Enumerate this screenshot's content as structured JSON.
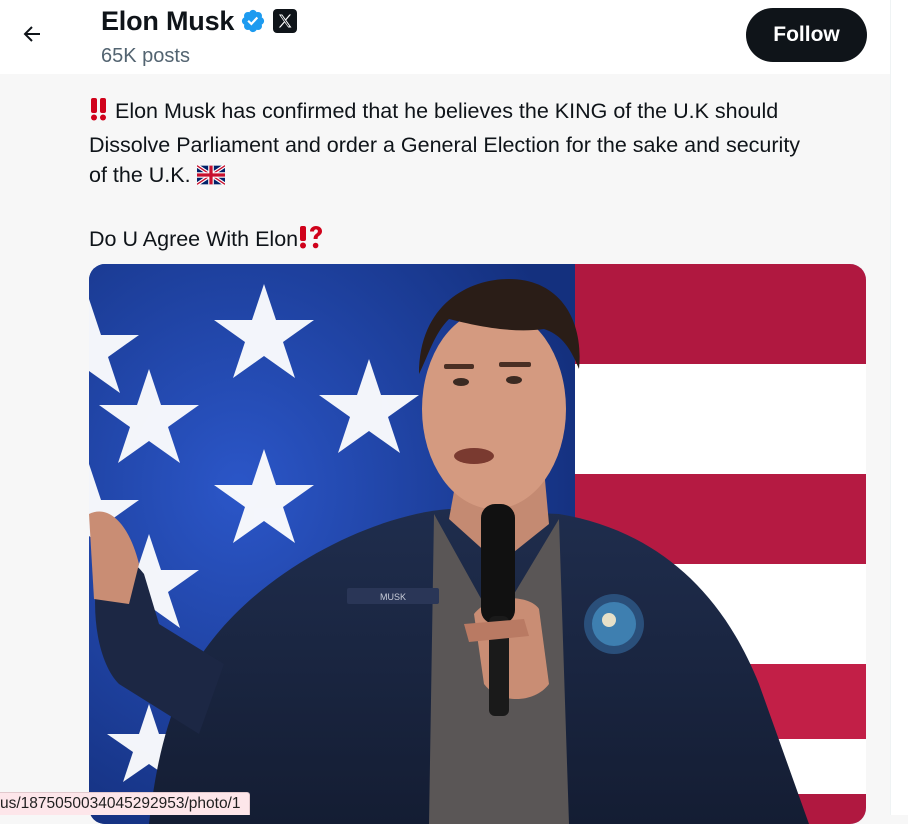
{
  "header": {
    "back_label": "Back",
    "display_name": "Elon Musk",
    "post_count": "65K posts",
    "follow_label": "Follow"
  },
  "post": {
    "line1": "Elon Musk has confirmed that he believes the KING of the U.K should",
    "line2": "Dissolve Parliament and order a General Election for the sake and security",
    "line3": "of the U.K.",
    "question": "Do U Agree With Elon",
    "emoji": {
      "lead": "double-exclamation",
      "flag": "uk-flag",
      "trail": "exclamation-question"
    }
  },
  "media": {
    "badge_text": "MUSK"
  },
  "status_bar": {
    "url": "us/1875050034045292953/photo/1"
  },
  "colors": {
    "follow_bg": "#0f1419",
    "verified": "#1d9bf0",
    "accent_red": "#d0021b"
  }
}
